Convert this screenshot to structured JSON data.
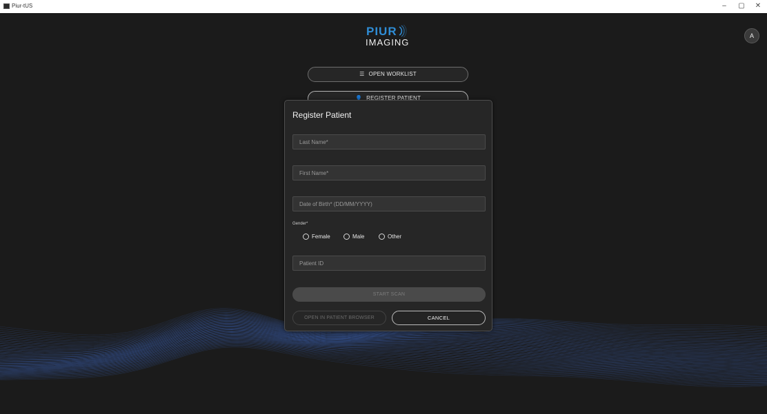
{
  "window": {
    "title": "Piur-tUS",
    "minimize_glyph": "–",
    "restore_glyph": "▢",
    "close_glyph": "✕"
  },
  "logo": {
    "line1": "PIUR",
    "line2": "IMAGING",
    "accent_color": "#2f8dd6"
  },
  "user": {
    "avatar_initial": "A"
  },
  "menu": {
    "open_worklist_icon": "checklist-icon",
    "open_worklist_label": "OPEN WORKLIST",
    "register_patient_icon": "add-person-icon",
    "register_patient_label": "REGISTER PATIENT"
  },
  "dialog": {
    "title": "Register Patient",
    "last_name": {
      "placeholder": "Last Name*",
      "value": ""
    },
    "first_name": {
      "placeholder": "First Name*",
      "value": ""
    },
    "dob": {
      "placeholder": "Date of Birth* (DD/MM/YYYY)",
      "value": ""
    },
    "gender_label": "Gender*",
    "gender_options": [
      "Female",
      "Male",
      "Other"
    ],
    "gender_selected": null,
    "patient_id": {
      "placeholder": "Patient ID",
      "value": ""
    },
    "start_scan_label": "START SCAN",
    "open_browser_label": "OPEN IN PATIENT BROWSER",
    "cancel_label": "CANCEL"
  },
  "theme": {
    "background": "#1b1b1b",
    "wave_color": "#3b63b8"
  }
}
